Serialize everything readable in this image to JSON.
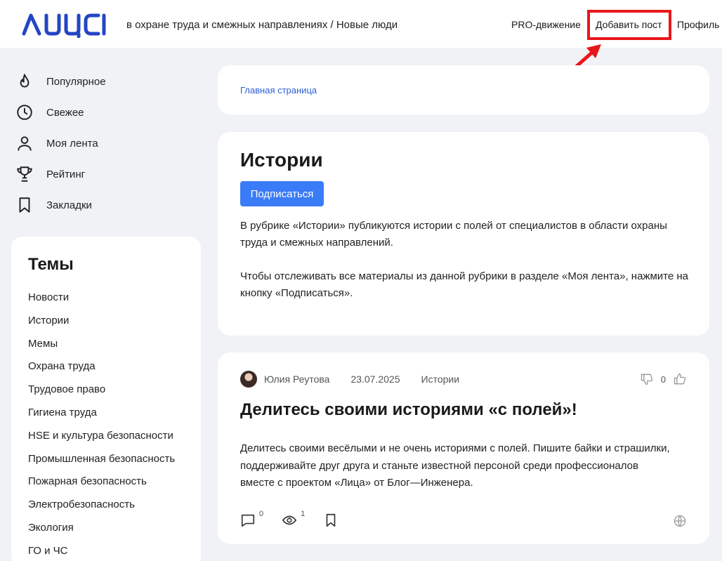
{
  "header": {
    "logo_text": "лица",
    "tagline": "в охране труда и смежных направлениях / Новые люди",
    "nav": {
      "pro": "PRO-движение",
      "add_post": "Добавить пост",
      "profile": "Профиль"
    },
    "highlight_color": "#e8161b"
  },
  "menu": {
    "items": [
      {
        "label": "Популярное",
        "icon": "fire-icon"
      },
      {
        "label": "Свежее",
        "icon": "clock-icon"
      },
      {
        "label": "Моя лента",
        "icon": "user-icon"
      },
      {
        "label": "Рейтинг",
        "icon": "trophy-icon"
      },
      {
        "label": "Закладки",
        "icon": "bookmark-icon"
      }
    ]
  },
  "topics": {
    "title": "Темы",
    "items": [
      "Новости",
      "Истории",
      "Мемы",
      "Охрана труда",
      "Трудовое право",
      "Гигиена труда",
      "HSE и культура безопасности",
      "Промышленная безопасность",
      "Пожарная безопасность",
      "Электробезопасность",
      "Экология",
      "ГО и ЧС"
    ]
  },
  "breadcrumb": "Главная страница",
  "rubric": {
    "title": "Истории",
    "subscribe_label": "Подписаться",
    "description_1": "В рубрике «Истории» публикуются истории с полей от специалистов в области охраны труда и смежных направлений.",
    "description_2": "Чтобы отслеживать все материалы из данной рубрики в разделе «Моя лента», нажмите на кнопку «Подписаться»."
  },
  "post": {
    "author": "Юлия Реутова",
    "date": "23.07.2025",
    "rubric": "Истории",
    "vote_count": "0",
    "title": "Делитесь своими историями «с полей»!",
    "body": "Делитесь своими весёлыми и не очень историями с полей. Пишите байки и страшилки, поддерживайте друг друга и станьте известной персоной среди профессионалов вместе с проектом «Лица» от Блог—Инженера.",
    "comments": "0",
    "views": "1"
  },
  "colors": {
    "accent": "#3a7bf7",
    "brand": "#2346c4",
    "link": "#2c5fd6",
    "background": "#f0f2f5"
  }
}
